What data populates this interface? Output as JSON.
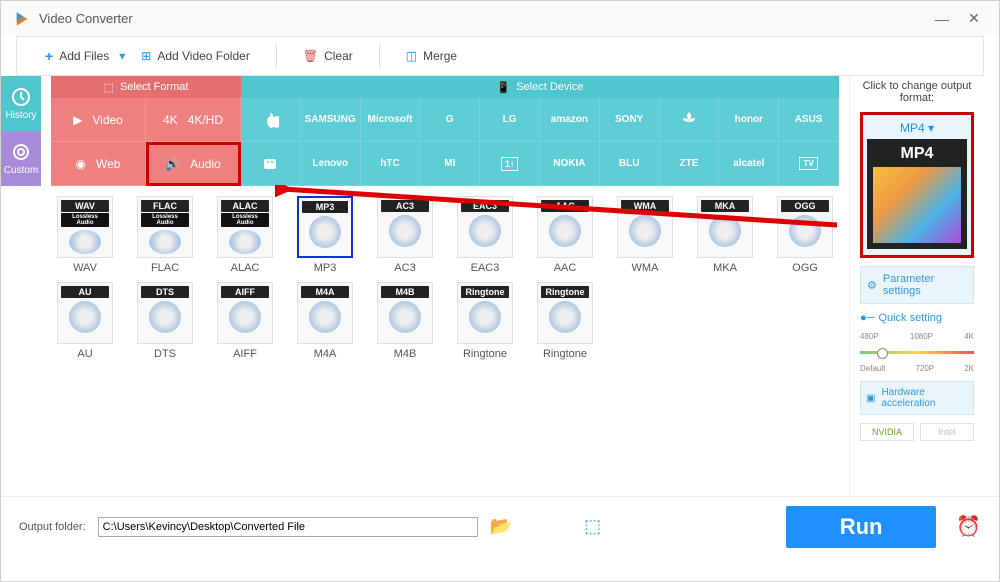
{
  "app": {
    "title": "Video Converter"
  },
  "toolbar": {
    "add_files": "Add Files",
    "add_folder": "Add Video Folder",
    "clear": "Clear",
    "merge": "Merge"
  },
  "left_tabs": {
    "history": "History",
    "custom": "Custom"
  },
  "head": {
    "format": "Select Format",
    "device": "Select Device"
  },
  "fmt_tabs": {
    "video": "Video",
    "hd": "4K/HD",
    "web": "Web",
    "audio": "Audio"
  },
  "devices": [
    "",
    "SAMSUNG",
    "Microsoft",
    "G",
    "LG",
    "amazon",
    "SONY",
    "",
    "honor",
    "ASUS",
    "",
    "Lenovo",
    "hTC",
    "MI",
    "",
    "NOKIA",
    "BLU",
    "ZTE",
    "alcatel",
    "TV"
  ],
  "audio_formats_row1": [
    {
      "name": "WAV",
      "lossless": true
    },
    {
      "name": "FLAC",
      "lossless": true
    },
    {
      "name": "ALAC",
      "lossless": true
    },
    {
      "name": "MP3",
      "selected": true
    },
    {
      "name": "AC3"
    },
    {
      "name": "EAC3"
    },
    {
      "name": "AAC"
    },
    {
      "name": "WMA"
    },
    {
      "name": "MKA"
    },
    {
      "name": "OGG"
    }
  ],
  "audio_formats_row2": [
    {
      "name": "AU"
    },
    {
      "name": "DTS"
    },
    {
      "name": "AIFF"
    },
    {
      "name": "M4A"
    },
    {
      "name": "M4B"
    },
    {
      "name": "Ringtone"
    },
    {
      "name": "Ringtone"
    }
  ],
  "right": {
    "title": "Click to change output format:",
    "format": "MP4",
    "thumb_label": "MP4",
    "param": "Parameter settings",
    "quick": "Quick setting",
    "ticks_top": [
      "480P",
      "1080P",
      "4K"
    ],
    "ticks_bot": [
      "Default",
      "720P",
      "2K"
    ],
    "hw": "Hardware acceleration",
    "gpu1": "NVIDIA",
    "gpu2": "Intel"
  },
  "bottom": {
    "label": "Output folder:",
    "path": "C:\\Users\\Kevincy\\Desktop\\Converted File",
    "run": "Run"
  }
}
